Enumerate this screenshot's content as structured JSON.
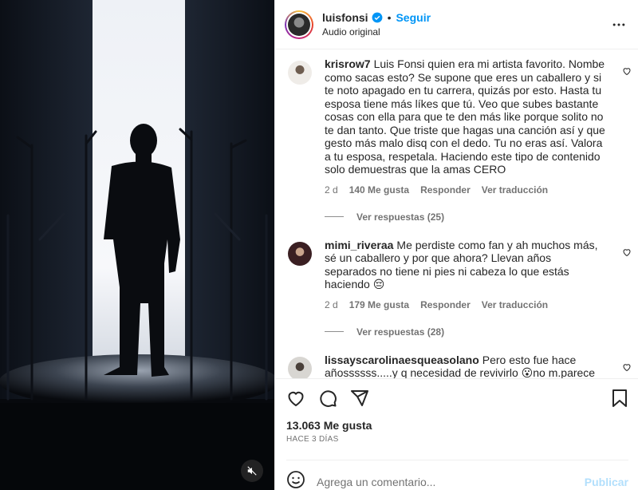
{
  "post": {
    "username": "luisfonsi",
    "follow_label": "Seguir",
    "dot": "•",
    "audio_label": "Audio original"
  },
  "comments": [
    {
      "username": "krisrow7",
      "text": "Luis Fonsi quien era mi artista favorito. Nombe como sacas esto? Se supone que eres un caballero y si te noto apagado en tu carrera, quizás por esto. Hasta tu esposa tiene más líkes que tú. Veo que subes bastante cosas con ella para que te den más like porque solito no te dan tanto. Que triste que hagas una canción así y que gesto más malo disq con el dedo. Tu no eras así. Valora a tu esposa, respetala. Haciendo este tipo de contenido solo demuestras que la amas CERO",
      "time": "2 d",
      "likes": "140 Me gusta",
      "reply": "Responder",
      "translate": "Ver traducción",
      "view_replies": "Ver respuestas (25)",
      "avatar_color": "#d9d4cf"
    },
    {
      "username": "mimi_riveraa",
      "text": "Me perdiste como fan y ah muchos más, sé un caballero y por que ahora? Llevan años separados no tiene ni pies ni cabeza lo que estás haciendo 😔",
      "time": "2 d",
      "likes": "179 Me gusta",
      "reply": "Responder",
      "translate": "Ver traducción",
      "view_replies": "Ver respuestas (28)",
      "avatar_color": "#6b3a3f"
    },
    {
      "username": "lissayscarolinaesqueasolano",
      "text": "Pero esto fue hace añossssss.....y q necesidad de revivirlo 😮no m.parece necesario....no apoyo esto ni x chisme",
      "avatar_color": "#8f8a85"
    }
  ],
  "actions": {
    "likes": "13.063 Me gusta",
    "date": "HACE 3 DÍAS"
  },
  "composer": {
    "placeholder": "Agrega un comentario...",
    "publish_label": "Publicar"
  },
  "colors": {
    "accent": "#0095f6",
    "verified": "#0095f6",
    "publish_disabled": "#b2dffc"
  }
}
